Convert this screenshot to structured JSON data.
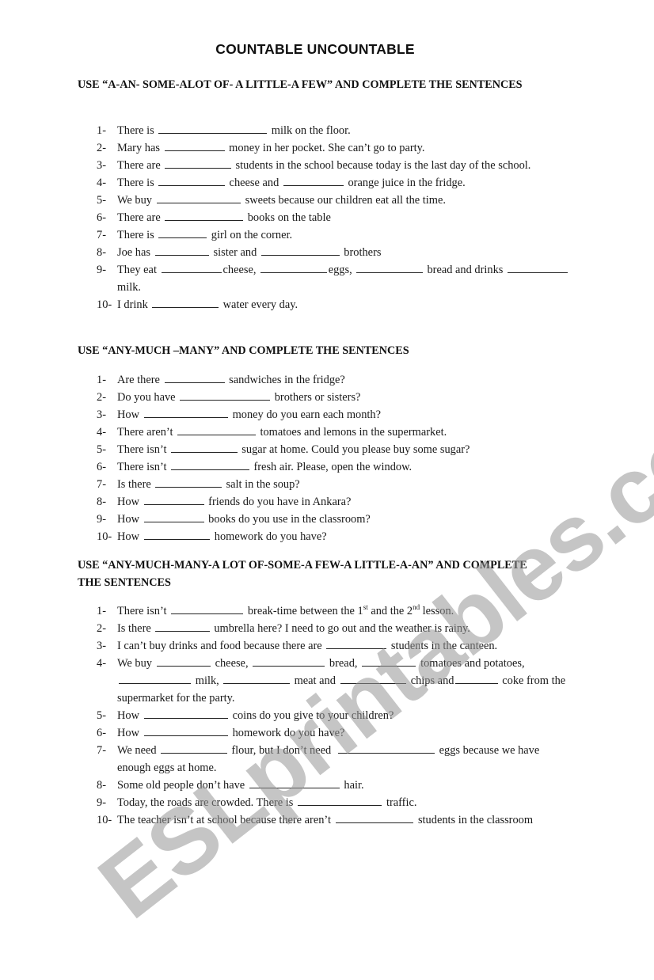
{
  "title": "COUNTABLE UNCOUNTABLE",
  "watermark": "ESLprintables.com",
  "sections": [
    {
      "heading": "USE “A-AN- SOME-ALOT OF- A LITTLE-A FEW” AND COMPLETE THE SENTENCES",
      "items": [
        {
          "num": "1-",
          "parts": [
            "There is ",
            "_18",
            " milk on the floor."
          ]
        },
        {
          "num": "2-",
          "parts": [
            "Mary has ",
            "_10",
            " money in her pocket. She can’t go to party."
          ]
        },
        {
          "num": "3-",
          "parts": [
            "There are ",
            "_11",
            " students in the school because today is the last day of the school."
          ]
        },
        {
          "num": "4-",
          "parts": [
            "There is ",
            "_11",
            " cheese and ",
            "_10",
            " orange juice in the fridge."
          ]
        },
        {
          "num": "5-",
          "parts": [
            "We buy ",
            "_14",
            " sweets because our children eat all the time."
          ]
        },
        {
          "num": "6-",
          "parts": [
            "There are ",
            "_13",
            " books on the table"
          ]
        },
        {
          "num": "7-",
          "parts": [
            "There is ",
            "_8",
            " girl on the corner."
          ]
        },
        {
          "num": "8-",
          "parts": [
            "Joe has ",
            "_9",
            " sister and ",
            "_13",
            " brothers"
          ]
        },
        {
          "num": "9-",
          "parts": [
            "They eat ",
            "_10",
            "cheese, ",
            "_11",
            "eggs, ",
            "_11",
            " bread and drinks ",
            "_10",
            " milk."
          ]
        },
        {
          "num": "10-",
          "parts": [
            "I drink ",
            "_11",
            " water every day."
          ]
        }
      ]
    },
    {
      "heading": "USE “ANY-MUCH –MANY” AND COMPLETE THE SENTENCES",
      "items": [
        {
          "num": "1-",
          "parts": [
            "Are there ",
            "_10",
            " sandwiches in the fridge?"
          ]
        },
        {
          "num": "2-",
          "parts": [
            "Do you have ",
            "_15",
            " brothers or sisters?"
          ]
        },
        {
          "num": "3-",
          "parts": [
            "How ",
            "_14",
            " money do you earn each month?"
          ]
        },
        {
          "num": "4-",
          "parts": [
            "There aren’t ",
            "_13",
            " tomatoes and lemons in the supermarket."
          ]
        },
        {
          "num": "5-",
          "parts": [
            "There isn’t ",
            "_11",
            " sugar at home. Could you please buy some sugar?"
          ]
        },
        {
          "num": "6-",
          "parts": [
            "There isn’t ",
            "_13",
            " fresh air. Please, open the window."
          ]
        },
        {
          "num": "7-",
          "parts": [
            "Is there ",
            "_11",
            " salt in the soup?"
          ]
        },
        {
          "num": "8-",
          "parts": [
            "How ",
            "_10",
            " friends do you have in Ankara?"
          ]
        },
        {
          "num": "9-",
          "parts": [
            "How ",
            "_10",
            " books do you use in the classroom?"
          ]
        },
        {
          "num": "10-",
          "parts": [
            "How ",
            "_11",
            " homework do you have?"
          ]
        }
      ]
    },
    {
      "heading": "USE “ANY-MUCH-MANY-A LOT OF-SOME-A FEW-A LITTLE-A-AN” AND COMPLETE THE SENTENCES",
      "items": [
        {
          "num": "1-",
          "parts": [
            "There isn’t ",
            "_12",
            " break-time between the 1",
            "^st",
            " and the 2",
            "^nd",
            " lesson."
          ]
        },
        {
          "num": "2-",
          "parts": [
            "Is there ",
            "_9",
            " umbrella here? I need to go out and the weather is rainy."
          ]
        },
        {
          "num": "3-",
          "parts": [
            "I can’t buy drinks and food because there are ",
            "_10",
            " students in the canteen."
          ]
        },
        {
          "num": "4-",
          "parts": [
            "We buy ",
            "_9",
            " cheese, ",
            "_12",
            " bread, ",
            "_9",
            " tomatoes and potatoes, ",
            "_12",
            " milk, ",
            "_11",
            " meat and ",
            "_11",
            " chips and",
            "_7",
            " coke from the supermarket for the party."
          ]
        },
        {
          "num": "5-",
          "parts": [
            "How ",
            "_14",
            " coins do you give to your children?"
          ]
        },
        {
          "num": "6-",
          "parts": [
            "How ",
            "_14",
            " homework do you have?"
          ]
        },
        {
          "num": "7-",
          "parts": [
            "We need ",
            "_11",
            " flour, but I don’t need  ",
            "_16",
            " eggs because we have enough eggs at home."
          ]
        },
        {
          "num": "8-",
          "parts": [
            "Some old people don’t have ",
            "_15",
            " hair."
          ]
        },
        {
          "num": "9-",
          "parts": [
            "Today, the roads are crowded. There is ",
            "_14",
            " traffic."
          ]
        },
        {
          "num": "10-",
          "parts": [
            "The teacher isn’t at school because there aren’t ",
            "_13",
            " students in the classroom"
          ]
        }
      ]
    }
  ]
}
